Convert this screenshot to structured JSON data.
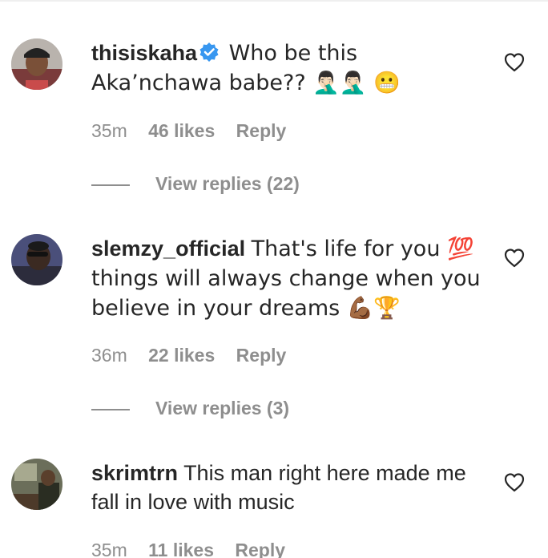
{
  "comments": [
    {
      "username": "thisiskaha",
      "verified": true,
      "text": "Who be this Aka’nchawa babe?? 🤦🏻‍♂️🤦🏻‍♂️ 😬",
      "time": "35m",
      "likes": "46 likes",
      "reply": "Reply",
      "view_replies": "View replies (22)",
      "avatar_icon": "profile-avatar-icon"
    },
    {
      "username": "slemzy_official",
      "verified": false,
      "text": "That's life for you 💯 things will always change when you believe in your dreams 💪🏾🏆",
      "time": "36m",
      "likes": "22 likes",
      "reply": "Reply",
      "view_replies": "View replies (3)",
      "avatar_icon": "profile-avatar-icon"
    },
    {
      "username": "skrimtrn",
      "verified": false,
      "text": "This man right here made me fall in love with music",
      "time": "35m",
      "likes": "11 likes",
      "reply": "Reply",
      "avatar_icon": "profile-avatar-icon"
    }
  ],
  "colors": {
    "text": "#262626",
    "secondary": "#8e8e8e",
    "verified_blue": "#3897f0"
  }
}
